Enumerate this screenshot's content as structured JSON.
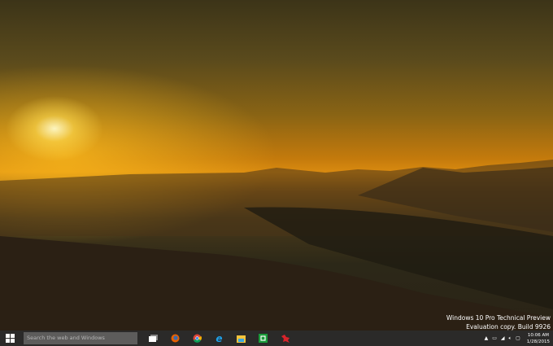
{
  "watermark": {
    "line1": "Windows 10 Pro Technical Preview",
    "line2": "Evaluation copy. Build 9926"
  },
  "taskbar": {
    "search_placeholder": "Search the web and Windows",
    "apps": [
      {
        "name": "task-view-icon"
      },
      {
        "name": "firefox-icon"
      },
      {
        "name": "chrome-icon"
      },
      {
        "name": "internet-explorer-icon"
      },
      {
        "name": "file-explorer-icon"
      },
      {
        "name": "store-icon"
      },
      {
        "name": "app-red-icon"
      }
    ],
    "time": "10:06 AM",
    "date": "1/28/2015"
  },
  "colors": {
    "taskbar": "#2b2a29",
    "search_box": "#5d5c5b"
  }
}
